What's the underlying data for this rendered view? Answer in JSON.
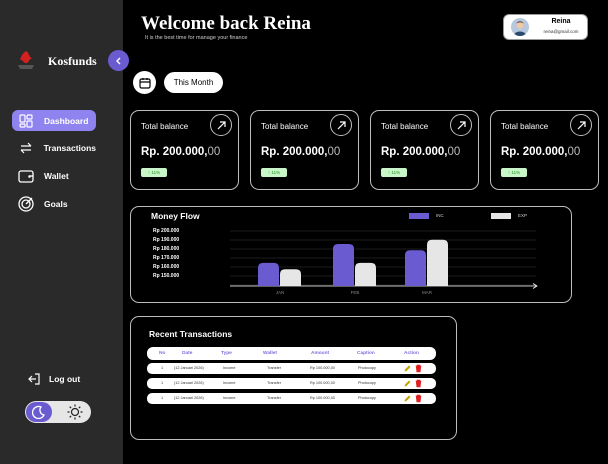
{
  "sidebar": {
    "brand": "Kosfunds",
    "nav": [
      {
        "label": "Dashboard",
        "icon": "dashboard-grid-icon",
        "active": true
      },
      {
        "label": "Transactions",
        "icon": "transfer-arrows-icon",
        "active": false
      },
      {
        "label": "Wallet",
        "icon": "wallet-icon",
        "active": false
      },
      {
        "label": "Goals",
        "icon": "target-icon",
        "active": false
      }
    ],
    "logout_label": "Log out"
  },
  "header": {
    "welcome": "Welcome back Reina",
    "subtitle": "It is the best time for manage your finance",
    "user_name": "Reina",
    "user_email": "reina@gmail.com",
    "period_label": "This Month"
  },
  "cards": [
    {
      "title": "Total balance",
      "amount": "Rp. 200.000,",
      "decimals": "00",
      "badge": "↑ 11%"
    },
    {
      "title": "Total balance",
      "amount": "Rp. 200.000,",
      "decimals": "00",
      "badge": "↑ 11%"
    },
    {
      "title": "Total balance",
      "amount": "Rp. 200.000,",
      "decimals": "00",
      "badge": "↑ 11%"
    },
    {
      "title": "Total balance",
      "amount": "Rp. 200.000,",
      "decimals": "00",
      "badge": "↑ 11%"
    }
  ],
  "money_flow": {
    "title": "Money Flow",
    "legend": [
      {
        "label": "INC",
        "color": "#6a5bd1"
      },
      {
        "label": "EXP",
        "color": "#e6e6e6"
      }
    ]
  },
  "chart_data": {
    "type": "bar",
    "title": "Money Flow",
    "categories": [
      "JAN",
      "FEB",
      "MAR"
    ],
    "y_tick_labels": [
      "Rp 200.000",
      "Rp 190.000",
      "Rp 180.000",
      "Rp 170.000",
      "Rp 160.000",
      "Rp 150.000"
    ],
    "series": [
      {
        "name": "INC",
        "color": "#6a5bd1",
        "values": [
          0.55,
          1.0,
          0.85
        ]
      },
      {
        "name": "EXP",
        "color": "#e6e6e6",
        "values": [
          0.4,
          0.55,
          1.1
        ]
      }
    ],
    "grid": true
  },
  "transactions": {
    "title": "Recent Transactions",
    "columns": [
      "No",
      "Date",
      "Type",
      "Wallet",
      "Amount",
      "Caption",
      "Action"
    ],
    "rows": [
      {
        "no": "1",
        "date": "(12 Januari 2026)",
        "type": "Income",
        "wallet": "Transfer",
        "amount": "Rp 100.000,00",
        "caption": "Photocopy"
      },
      {
        "no": "1",
        "date": "(12 Januari 2026)",
        "type": "Income",
        "wallet": "Transfer",
        "amount": "Rp 100.000,00",
        "caption": "Photocopy"
      },
      {
        "no": "1",
        "date": "(12 Januari 2026)",
        "type": "Income",
        "wallet": "Transfer",
        "amount": "Rp 100.000,00",
        "caption": "Photocopy"
      }
    ]
  }
}
